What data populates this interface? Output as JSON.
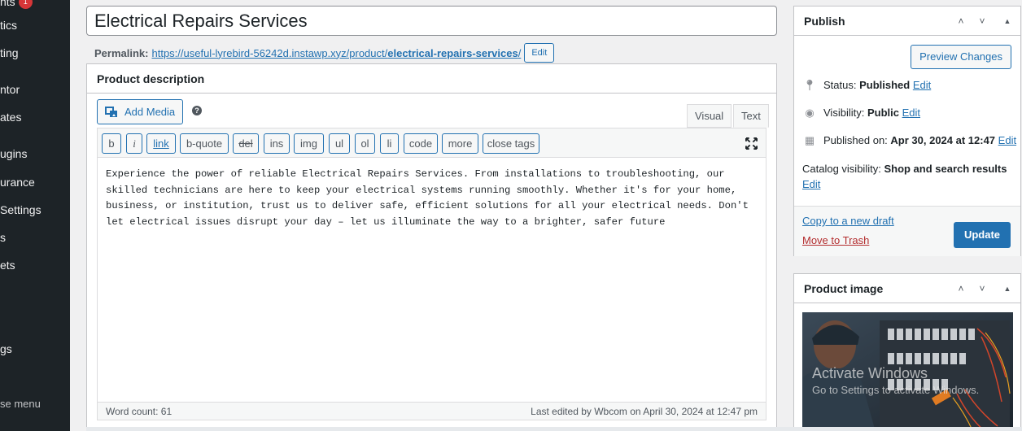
{
  "sidebar": {
    "items": [
      {
        "label": "nts",
        "badge": "1"
      },
      {
        "label": "tics"
      },
      {
        "label": "ting"
      },
      {
        "label": "ntor"
      },
      {
        "label": "ates"
      },
      {
        "label": "ugins"
      },
      {
        "label": "urance"
      },
      {
        "label": "Settings"
      },
      {
        "label": "s"
      },
      {
        "label": "ets"
      },
      {
        "label": "gs"
      }
    ],
    "collapse_label": "se menu"
  },
  "post": {
    "title": "Electrical Repairs Services",
    "permalink_label": "Permalink:",
    "permalink_base": "https://useful-lyrebird-56242d.instawp.xyz/product/",
    "permalink_slug": "electrical-repairs-services",
    "permalink_trailing": "/",
    "permalink_edit": "Edit"
  },
  "description": {
    "heading": "Product description",
    "add_media": "Add Media",
    "help": "?",
    "tabs": {
      "visual": "Visual",
      "text": "Text"
    },
    "quicktags": [
      "b",
      "i",
      "link",
      "b-quote",
      "del",
      "ins",
      "img",
      "ul",
      "ol",
      "li",
      "code",
      "more",
      "close tags"
    ],
    "content": "Experience the power of reliable Electrical Repairs Services. From installations to troubleshooting, our skilled technicians are here to keep your electrical systems running smoothly. Whether it's for your home, business, or institution, trust us to deliver safe, efficient solutions for all your electrical needs. Don't let electrical issues disrupt your day – let us illuminate the way to a brighter, safer future",
    "word_count": "Word count: 61",
    "last_edited": "Last edited by Wbcom on April 30, 2024 at 12:47 pm"
  },
  "publish": {
    "heading": "Publish",
    "preview": "Preview Changes",
    "status_label": "Status:",
    "status_value": "Published",
    "visibility_label": "Visibility:",
    "visibility_value": "Public",
    "published_label": "Published on:",
    "published_value": "Apr 30, 2024 at 12:47",
    "catalog_label": "Catalog visibility:",
    "catalog_value": "Shop and search results",
    "edit": "Edit",
    "copy_draft": "Copy to a new draft",
    "trash": "Move to Trash",
    "update": "Update"
  },
  "product_image": {
    "heading": "Product image"
  },
  "watermark": {
    "title": "Activate Windows",
    "subtitle": "Go to Settings to activate Windows."
  },
  "colors": {
    "accent": "#2271b1",
    "sidebar": "#1d2327",
    "danger": "#b32d2e"
  }
}
